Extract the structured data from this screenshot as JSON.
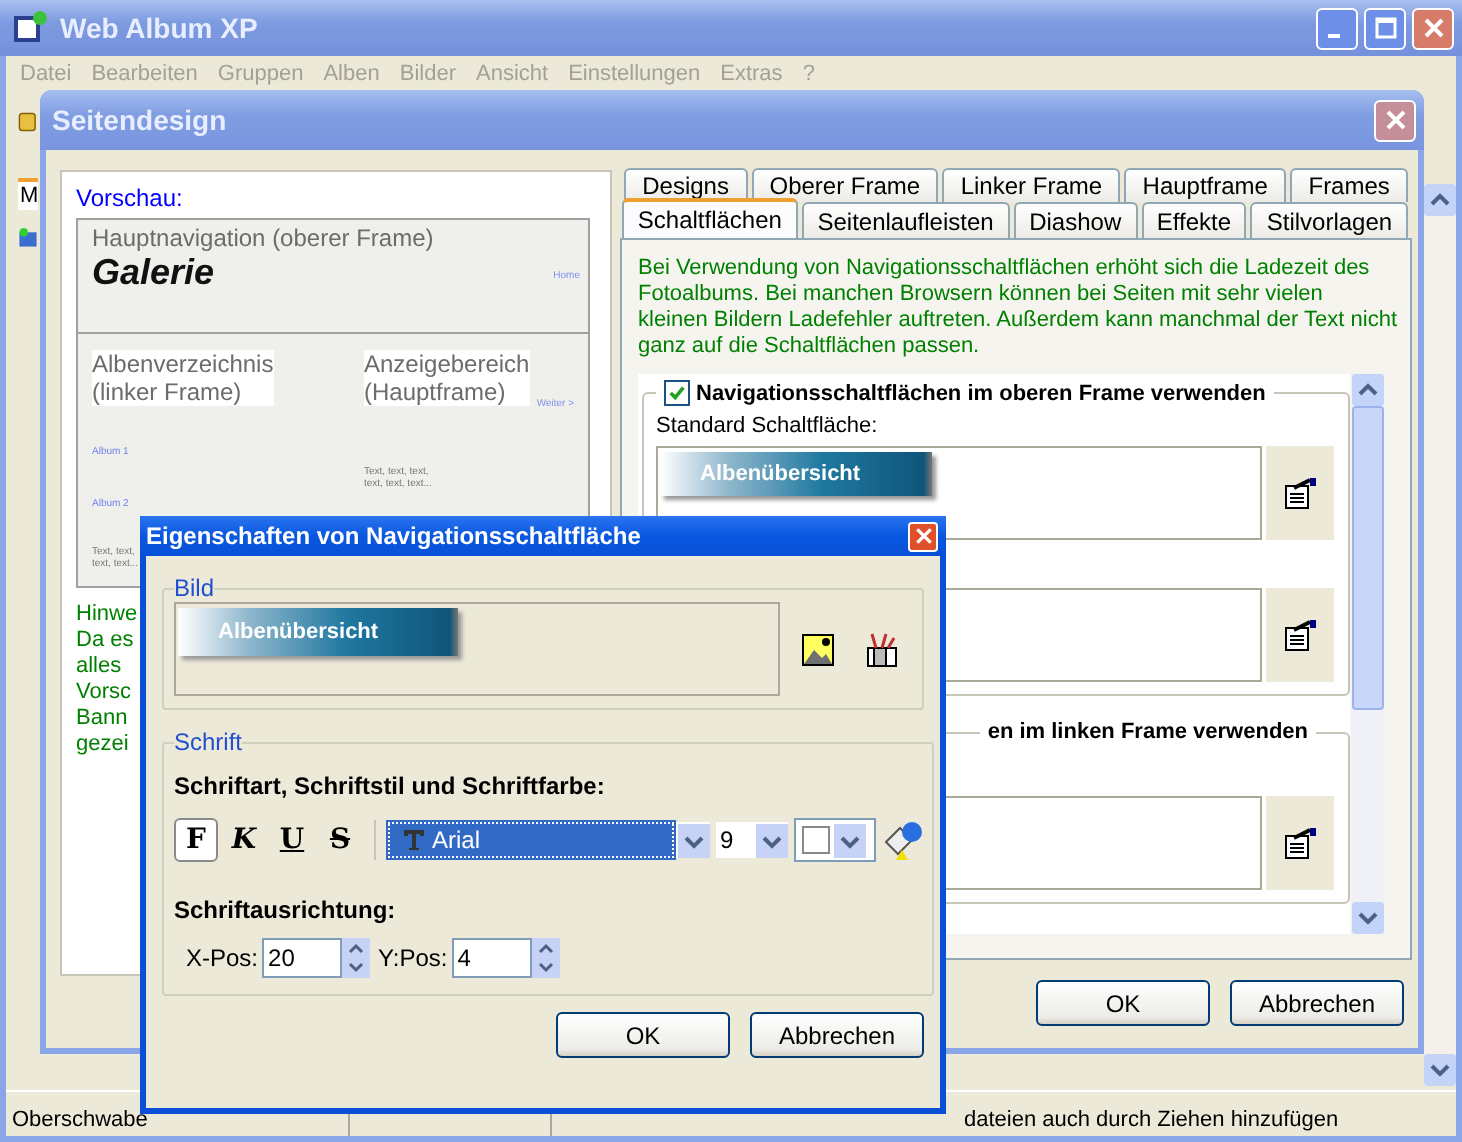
{
  "main_window": {
    "title": "Web Album XP",
    "menu": [
      {
        "label": "Datei",
        "disabled": true
      },
      {
        "label": "Bearbeiten",
        "disabled": true
      },
      {
        "label": "Gruppen",
        "disabled": true
      },
      {
        "label": "Alben",
        "disabled": true
      },
      {
        "label": "Bilder",
        "disabled": true
      },
      {
        "label": "Ansicht",
        "disabled": true
      },
      {
        "label": "Einstellungen",
        "disabled": true
      },
      {
        "label": "Extras",
        "disabled": true
      },
      {
        "label": "?",
        "disabled": true
      }
    ],
    "side_tab": "M",
    "status_bar": [
      "Oberschwabe",
      "dateien auch durch Ziehen hinzufügen"
    ]
  },
  "page_design_dialog": {
    "title": "Seitendesign",
    "preview": {
      "label": "Vorschau:",
      "top_frame": "Hauptnavigation (oberer Frame)",
      "gallery_title": "Galerie",
      "home_link": "Home",
      "left_frame": "Albenverzeichnis\n(linker Frame)",
      "main_frame": "Anzeigebereich\n(Hauptframe)",
      "next_link": "Weiter >",
      "albums": [
        "Album 1",
        "Album 2"
      ],
      "left_text": "Text, text,\ntext, text...",
      "main_text": "Text, text, text,\ntext, text, text..."
    },
    "hint_lines": [
      "Hinwe",
      "Da es",
      "alles",
      "Vorsc",
      "Bann",
      "gezei"
    ],
    "tab_rows": [
      [
        {
          "label": "Designs",
          "selected": false
        },
        {
          "label": "Oberer Frame",
          "selected": false
        },
        {
          "label": "Linker Frame",
          "selected": false
        },
        {
          "label": "Hauptframe",
          "selected": false
        },
        {
          "label": "Frames",
          "selected": false
        }
      ],
      [
        {
          "label": "Schaltflächen",
          "selected": true
        },
        {
          "label": "Seitenlaufleisten",
          "selected": false
        },
        {
          "label": "Diashow",
          "selected": false
        },
        {
          "label": "Effekte",
          "selected": false
        },
        {
          "label": "Stilvorlagen",
          "selected": false
        }
      ]
    ],
    "info": "Bei Verwendung von Navigationsschaltflächen erhöht sich die Ladezeit des Fotoalbums. Bei manchen Browsern können bei Seiten mit sehr vielen kleinen Bildern Ladefehler auftreten. Außerdem kann manchmal der Text nicht ganz auf die Schaltflächen passen.",
    "sections": [
      {
        "legend": "Navigationsschaltflächen im oberen Frame verwenden",
        "checked": true,
        "boxes": [
          {
            "kind": "image",
            "label": "Standard Schaltfläche:",
            "button_text": "Albenübersicht"
          },
          {
            "kind": "image"
          }
        ]
      },
      {
        "legend": "en im linken Frame verwenden",
        "boxes": [
          {
            "kind": "image"
          }
        ]
      }
    ],
    "buttons": [
      "OK",
      "Abbrechen"
    ]
  },
  "button_dialog": {
    "title": "Eigenschaften von Navigationsschaltfläche",
    "image_group": {
      "legend": "Bild",
      "button_text": "Albenübersicht"
    },
    "font_group": {
      "legend": "Schrift",
      "heading": "Schriftart, Schriftstil und Schriftfarbe:",
      "styles": [
        {
          "kind": "bold",
          "label": "F",
          "selected": true
        },
        {
          "kind": "italic",
          "label": "K",
          "selected": false
        },
        {
          "kind": "underline",
          "label": "U",
          "selected": false
        },
        {
          "kind": "strike",
          "label": "S",
          "selected": false
        }
      ],
      "font": "Arial",
      "size": "9",
      "alignment_heading": "Schriftausrichtung:",
      "x_label": "X-Pos:",
      "x_value": "20",
      "y_label": "Y:Pos:",
      "y_value": "4"
    },
    "buttons": [
      "OK",
      "Abbrechen"
    ]
  }
}
